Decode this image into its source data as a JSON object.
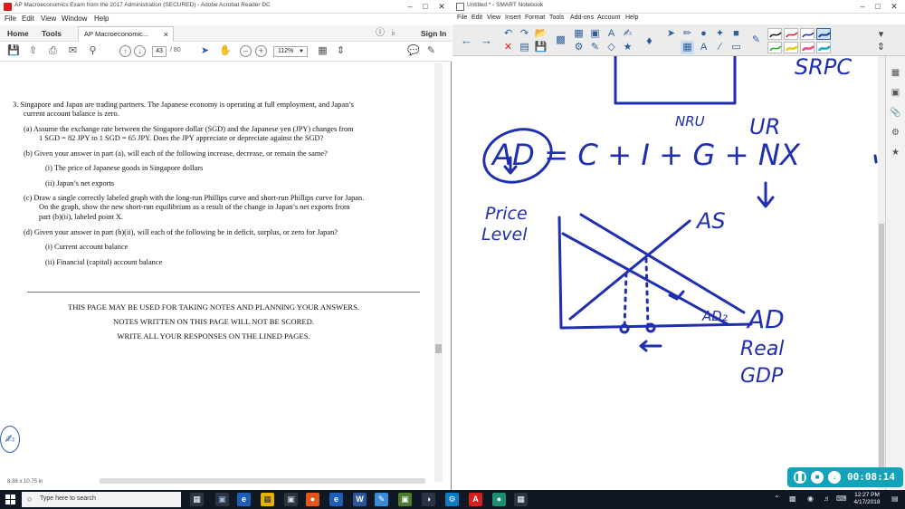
{
  "acrobat": {
    "title": "AP Macroeconomics Exam from the 2017 Administration (SECURED) - Adobe Acrobat Reader DC",
    "menu": [
      "File",
      "Edit",
      "View",
      "Window",
      "Help"
    ],
    "tabs": {
      "home": "Home",
      "tools": "Tools",
      "document": "AP Macroeconomic...",
      "sign_in": "Sign In"
    },
    "page_current": "43",
    "page_total": "/ 80",
    "zoom": "112%",
    "page_size": "8.38 x 10.75 in",
    "question": {
      "lines": [
        "3.  Singapore and Japan are trading partners. The Japanese economy is operating at full employment, and Japan’s",
        "current account balance is zero.",
        "(a)  Assume the exchange rate between the Singapore dollar (SGD) and the Japanese yen (JPY) changes from",
        "1 SGD = 82 JPY to 1 SGD = 65 JPY. Does the JPY appreciate or depreciate against the SGD?",
        "(b)  Given your answer in part (a), will each of the following increase, decrease, or remain the same?",
        "(i)   The price of Japanese goods in Singapore dollars",
        "(ii)  Japan’s net exports",
        "(c)  Draw a single correctly labeled graph with the long-run Phillips curve and short-run Phillips curve for Japan.",
        "On the graph, show the new short-run equilibrium as a result of the change in Japan’s net exports from",
        "part (b)(ii), labeled point X.",
        "(d)  Given your answer in part (b)(ii), will each of the following be in deficit, surplus, or zero for Japan?",
        "(i)   Current account balance",
        "(ii)  Financial (capital) account balance"
      ]
    },
    "notes": [
      "THIS PAGE MAY BE USED FOR TAKING NOTES AND PLANNING YOUR ANSWERS.",
      "NOTES WRITTEN ON THIS PAGE WILL NOT BE SCORED.",
      "WRITE ALL YOUR RESPONSES ON THE LINED PAGES."
    ]
  },
  "notebook": {
    "title": "Untitled * - SMART Notebook",
    "menu": [
      "File",
      "Edit",
      "View",
      "Insert",
      "Format",
      "Tools",
      "Add-ons",
      "Account",
      "Help"
    ],
    "ink_color": "#1f2fb0",
    "handwriting": {
      "srpc": "SRPC",
      "nru": "NRU",
      "ur": "UR",
      "equation": "AD = C + I + G + NX",
      "price_level_1": "Price",
      "price_level_2": "Level",
      "as": "AS",
      "ad": "AD",
      "ad2": "AD₂",
      "real_1": "Real",
      "real_2": "GDP"
    }
  },
  "recorder": {
    "time": "00:08:14",
    "accent": "#12a3b8"
  },
  "taskbar": {
    "search_placeholder": "Type here to search",
    "time": "12:27 PM",
    "date": "4/17/2018"
  }
}
